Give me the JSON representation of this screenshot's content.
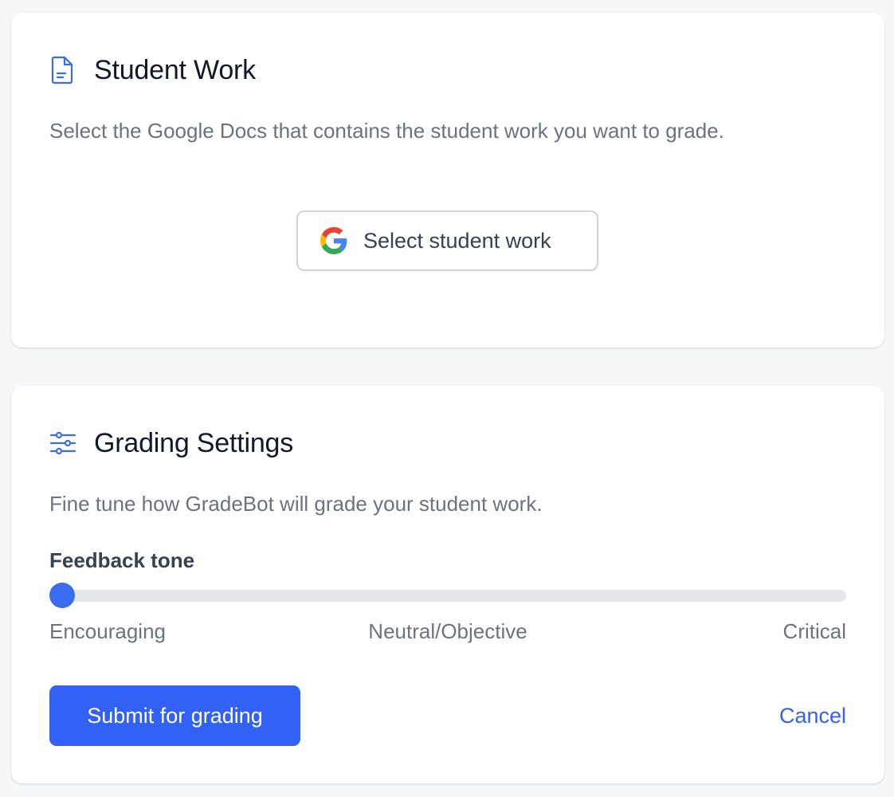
{
  "student_work": {
    "title": "Student Work",
    "icon": "document-icon",
    "description": "Select the Google Docs that contains the student work you want to grade.",
    "select_button": {
      "label": "Select student work",
      "icon": "google-icon"
    }
  },
  "grading_settings": {
    "title": "Grading Settings",
    "icon": "sliders-icon",
    "description": "Fine tune how GradeBot will grade your student work.",
    "feedback_tone": {
      "label": "Feedback tone",
      "value": 0,
      "min": 0,
      "max": 100,
      "scale_labels": {
        "left": "Encouraging",
        "middle": "Neutral/Objective",
        "right": "Critical"
      }
    },
    "submit_label": "Submit for grading",
    "cancel_label": "Cancel"
  },
  "colors": {
    "accent": "#3461f5",
    "icon_blue": "#3b6cf0",
    "page_bg": "#f7f8fa"
  }
}
